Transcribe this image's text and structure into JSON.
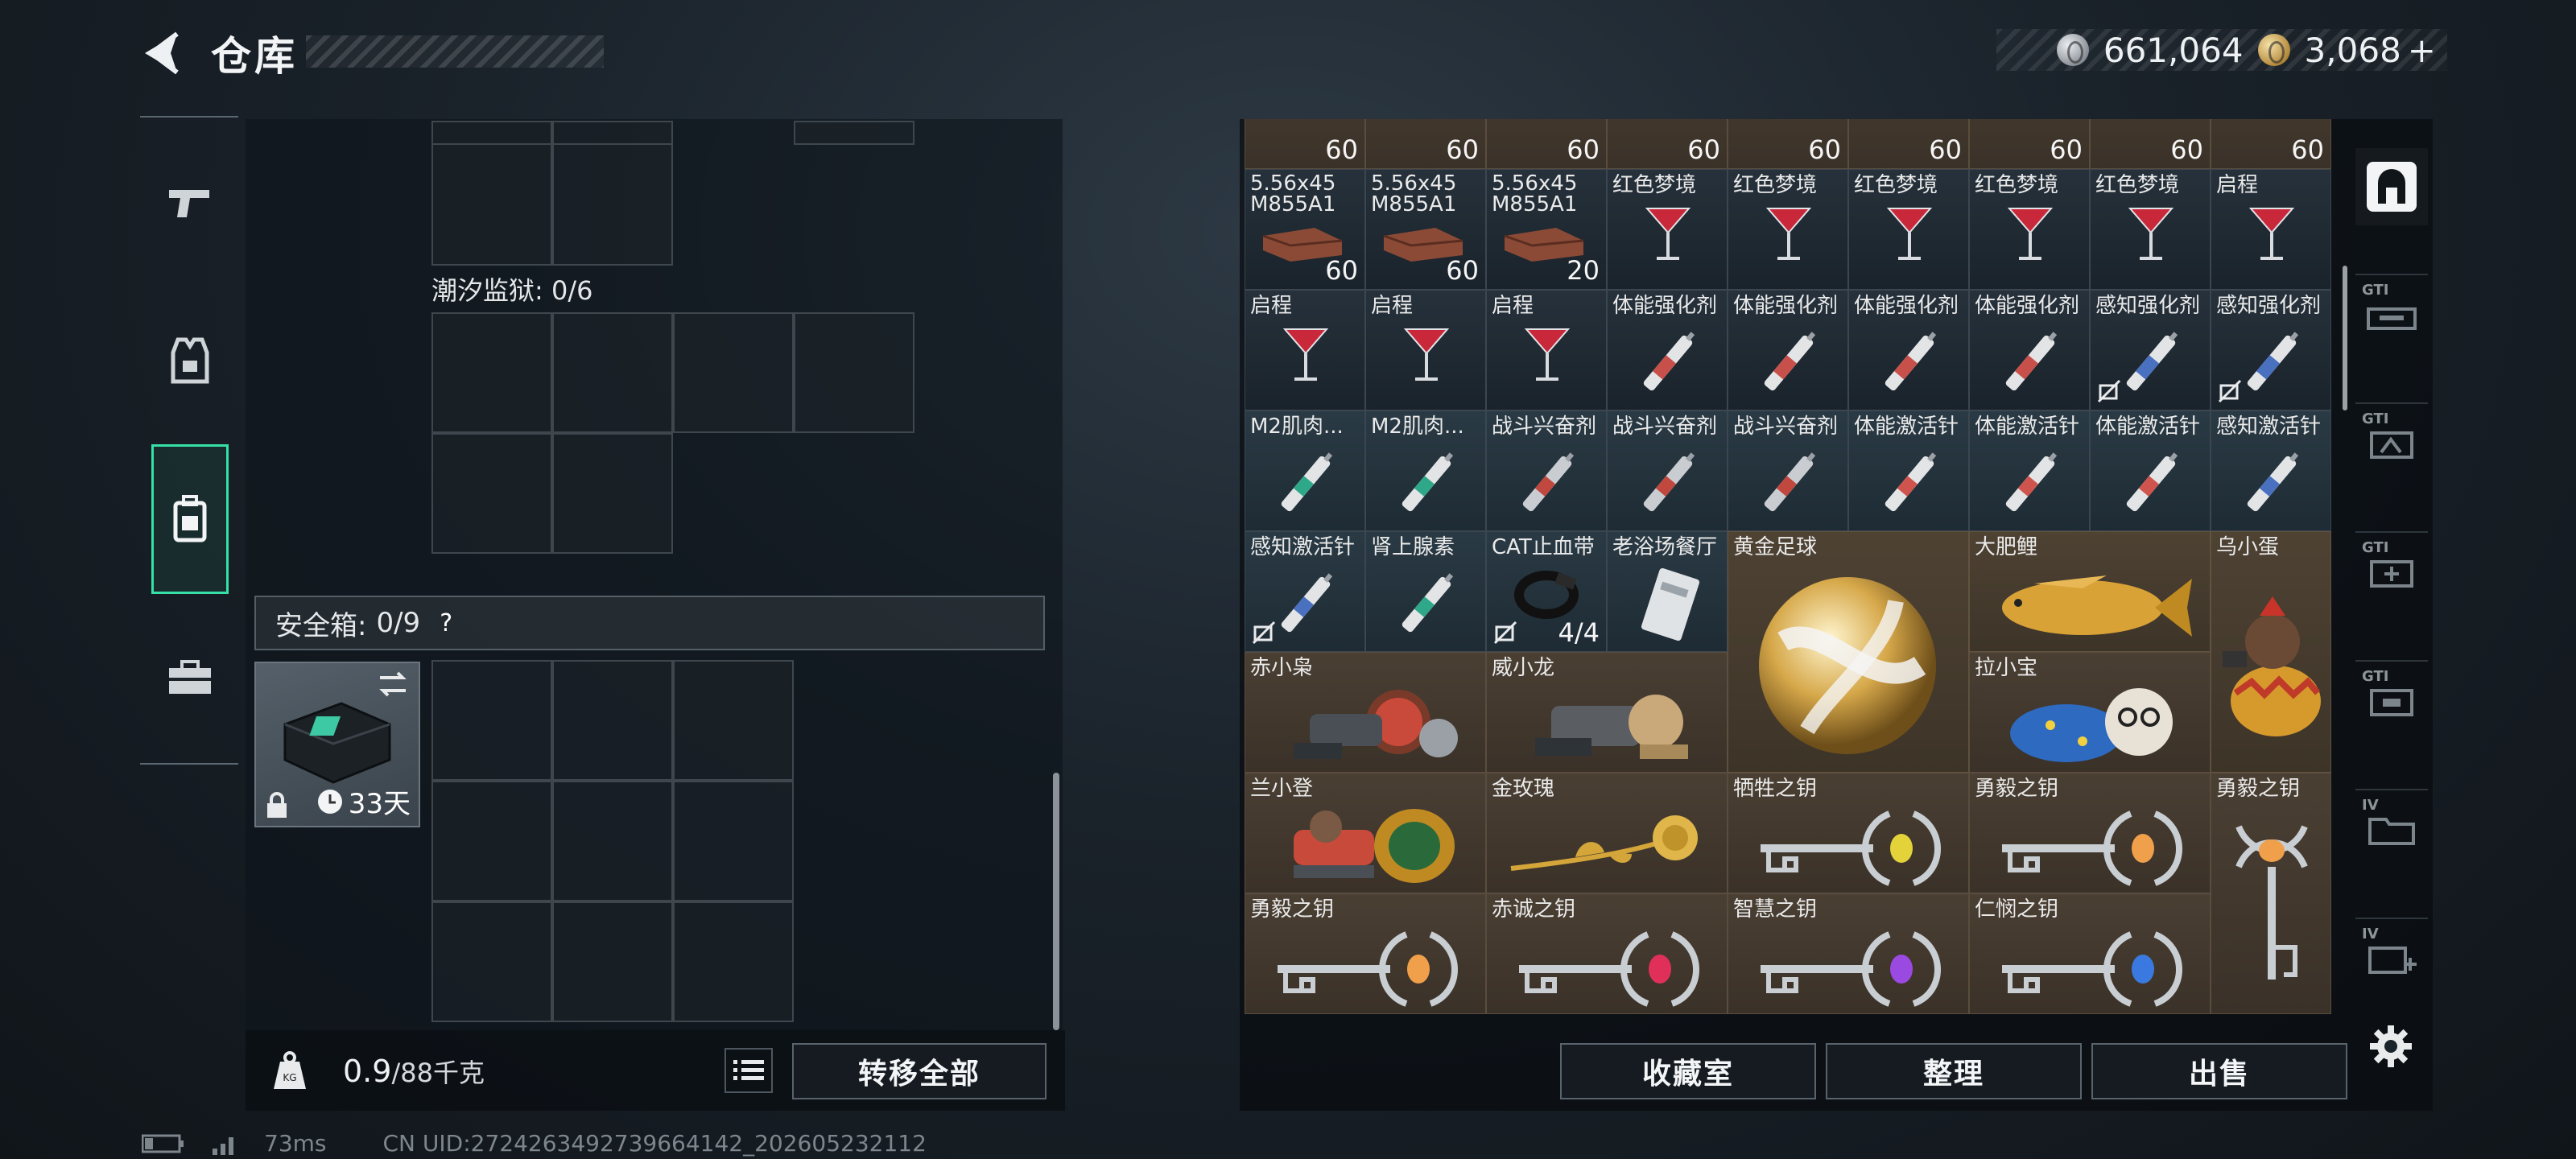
{
  "header": {
    "title": "仓库",
    "silver_amount": "661,064",
    "gold_amount": "3,068",
    "gold_plus": "+"
  },
  "left": {
    "tide_prison_label": "潮汐监狱: 0/6",
    "safe_box_label": "安全箱:",
    "safe_box_count": "0/9",
    "safe_help": "?",
    "safe_days": "33天",
    "weight_current": "0.9",
    "weight_max": "/88千克",
    "transfer_all": "转移全部"
  },
  "warehouse": {
    "top_counts": [
      "60",
      "60",
      "60",
      "60",
      "60",
      "60",
      "60",
      "60",
      "60"
    ],
    "row1": [
      {
        "name": "5.56x45 M855A1",
        "count": "60"
      },
      {
        "name": "5.56x45 M855A1",
        "count": "60"
      },
      {
        "name": "5.56x45 M855A1",
        "count": "20"
      },
      {
        "name": "红色梦境"
      },
      {
        "name": "红色梦境"
      },
      {
        "name": "红色梦境"
      },
      {
        "name": "红色梦境"
      },
      {
        "name": "红色梦境"
      },
      {
        "name": "启程"
      }
    ],
    "row2": [
      {
        "name": "启程"
      },
      {
        "name": "启程"
      },
      {
        "name": "启程"
      },
      {
        "name": "体能强化剂"
      },
      {
        "name": "体能强化剂"
      },
      {
        "name": "体能强化剂"
      },
      {
        "name": "体能强化剂"
      },
      {
        "name": "感知强化剂"
      },
      {
        "name": "感知强化剂"
      }
    ],
    "row3": [
      {
        "name": "M2肌肉..."
      },
      {
        "name": "M2肌肉..."
      },
      {
        "name": "战斗兴奋剂"
      },
      {
        "name": "战斗兴奋剂"
      },
      {
        "name": "战斗兴奋剂"
      },
      {
        "name": "体能激活针"
      },
      {
        "name": "体能激活针"
      },
      {
        "name": "体能激活针"
      },
      {
        "name": "感知激活针"
      }
    ],
    "row4": [
      {
        "name": "感知激活针"
      },
      {
        "name": "肾上腺素"
      },
      {
        "name": "CAT止血带",
        "count": "4/4"
      },
      {
        "name": "老浴场餐厅"
      }
    ],
    "big_items": {
      "golden_ball": "黄金足球",
      "fat_carp": "大肥鲤",
      "black_egg": "乌小蛋",
      "chi_xiao_xiao": "赤小枭",
      "wei_xiao_long": "威小龙",
      "la_xiao_bao": "拉小宝",
      "lan_xiao_deng": "兰小登",
      "gold_rose": "金玫瑰",
      "sacrifice_key": "牺牲之钥",
      "courage_key_1": "勇毅之钥",
      "courage_key_2": "勇毅之钥",
      "courage_key_3": "勇毅之钥",
      "loyal_key": "赤诚之钥",
      "wisdom_key": "智慧之钥",
      "mercy_key": "仁悯之钥"
    },
    "buttons": {
      "collection": "收藏室",
      "sort": "整理",
      "sell": "出售"
    }
  },
  "right_tabs": [
    "GTI",
    "GTI",
    "GTI",
    "GTI",
    "IV",
    "IV"
  ],
  "status": {
    "ping": "73ms",
    "uid": "CN UID:2724263492739664142_202605232112"
  },
  "colors": {
    "accent": "#36e0a6",
    "panel": "#0e141a",
    "item_bg": "#1f2932",
    "brown_bg": "#43392e"
  }
}
